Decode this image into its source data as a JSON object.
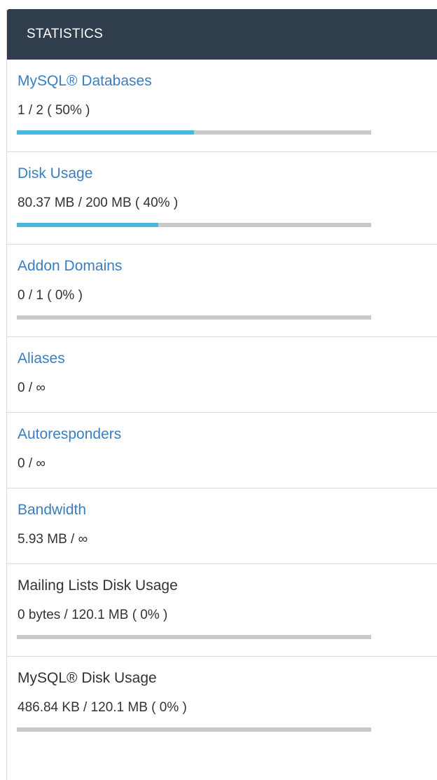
{
  "header": {
    "title": "STATISTICS"
  },
  "stats": [
    {
      "title": "MySQL® Databases",
      "value": "1 / 2 ( 50% )",
      "percent": 50,
      "link": true
    },
    {
      "title": "Disk Usage",
      "value": "80.37 MB / 200 MB ( 40% )",
      "percent": 40,
      "link": true
    },
    {
      "title": "Addon Domains",
      "value": "0 / 1 ( 0% )",
      "percent": 0,
      "link": true
    },
    {
      "title": "Aliases",
      "value": "0 / ∞",
      "link": true
    },
    {
      "title": "Autoresponders",
      "value": "0 / ∞",
      "link": true
    },
    {
      "title": "Bandwidth",
      "value": "5.93 MB / ∞",
      "link": true
    },
    {
      "title": "Mailing Lists Disk Usage",
      "value": "0 bytes / 120.1 MB ( 0% )",
      "percent": 0,
      "link": false
    },
    {
      "title": "MySQL® Disk Usage",
      "value": "486.84 KB / 120.1 MB ( 0% )",
      "percent": 0,
      "link": false
    }
  ],
  "colors": {
    "header_bg": "#2f3d4d",
    "link": "#3a7ec1",
    "bar_fill": "#4ab8dc",
    "bar_track": "#c9c9c9"
  }
}
